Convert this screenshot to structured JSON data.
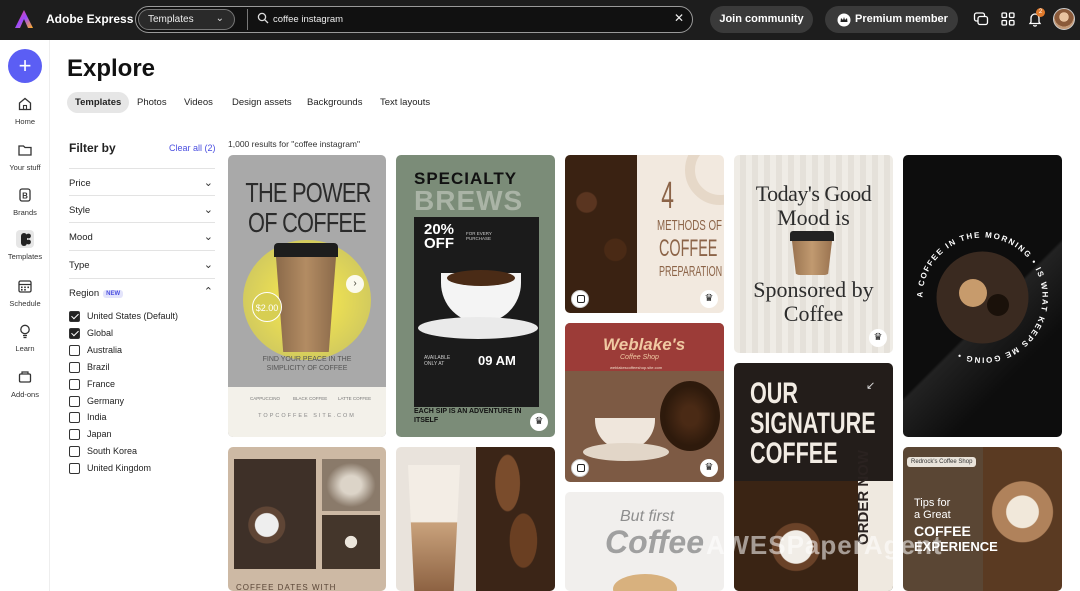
{
  "app": {
    "name": "Adobe Express"
  },
  "search": {
    "scope": "Templates",
    "query": "coffee instagram"
  },
  "header": {
    "join_label": "Join community",
    "premium_label": "Premium member",
    "notification_count": "2"
  },
  "nav": {
    "items": [
      {
        "label": "Home"
      },
      {
        "label": "Your stuff"
      },
      {
        "label": "Brands"
      },
      {
        "label": "Templates"
      },
      {
        "label": "Schedule"
      },
      {
        "label": "Learn"
      },
      {
        "label": "Add-ons"
      }
    ],
    "active": "Templates"
  },
  "page": {
    "title": "Explore"
  },
  "tabs": [
    {
      "label": "Templates"
    },
    {
      "label": "Photos"
    },
    {
      "label": "Videos"
    },
    {
      "label": "Design assets"
    },
    {
      "label": "Backgrounds"
    },
    {
      "label": "Text layouts"
    }
  ],
  "filters": {
    "title": "Filter by",
    "clear_label": "Clear all (2)",
    "sections": [
      {
        "label": "Price"
      },
      {
        "label": "Style"
      },
      {
        "label": "Mood"
      },
      {
        "label": "Type"
      }
    ],
    "region": {
      "label": "Region",
      "badge": "NEW",
      "options": [
        {
          "label": "United States (Default)",
          "checked": true
        },
        {
          "label": "Global",
          "checked": true
        },
        {
          "label": "Australia",
          "checked": false
        },
        {
          "label": "Brazil",
          "checked": false
        },
        {
          "label": "France",
          "checked": false
        },
        {
          "label": "Germany",
          "checked": false
        },
        {
          "label": "India",
          "checked": false
        },
        {
          "label": "Japan",
          "checked": false
        },
        {
          "label": "South Korea",
          "checked": false
        },
        {
          "label": "United Kingdom",
          "checked": false
        }
      ]
    }
  },
  "results": {
    "count_text": "1,000 results for \"coffee instagram\""
  },
  "templates": {
    "t1": {
      "line1": "THE POWER",
      "line2": "OF COFFEE",
      "price": "$2.00",
      "tagline": "FIND YOUR PEACE IN THE SIMPLICITY OF COFFEE",
      "menu": [
        "CAPPUCCINO",
        "BLACK COFFEE",
        "LATTE COFFEE"
      ],
      "site": "TOPCOFFEE SITE.COM"
    },
    "t2": {
      "line1": "SPECIALTY",
      "line2": "BREWS",
      "offer": "20% OFF",
      "offer_note": "FOR EVERY PURCHASE",
      "avail": "AVAILABLE ONLY AT",
      "time": "09 AM",
      "foot": "EACH SIP IS AN ADVENTURE IN ITSELF"
    },
    "t3": {
      "num": "4",
      "line1": "METHODS OF",
      "line2": "COFFEE",
      "line3": "PREPARATION"
    },
    "t4": {
      "line1": "Today's Good",
      "line2": "Mood is",
      "line3": "Sponsored by",
      "line4": "Coffee"
    },
    "t5": {
      "ring": "A COFFEE IN THE MORNING • IS WHAT KEEPS ME GOING •"
    },
    "t6": {
      "name": "Weblake's",
      "sub": "Coffee Shop",
      "site": "weblakescoffeeshop.site.com"
    },
    "t7": {
      "line1": "OUR",
      "line2": "SIGNATURE",
      "line3": "COFFEE",
      "side": "ORDER NOW"
    },
    "t8": {
      "caption": "COFFEE DATES WITH"
    },
    "t9": {
      "line1": "But first",
      "line2": "Coffee"
    },
    "t10": {
      "shop": "Redrock's Coffee Shop",
      "line1": "Tips for",
      "line2": "a Great",
      "line3": "COFFEE",
      "line4": "EXPERIENCE"
    }
  },
  "watermark": "AWESPaperAgent",
  "colors": {
    "accent": "#5b5ef4",
    "link": "#4b4fe0",
    "topbar": "#1d1d1d"
  }
}
